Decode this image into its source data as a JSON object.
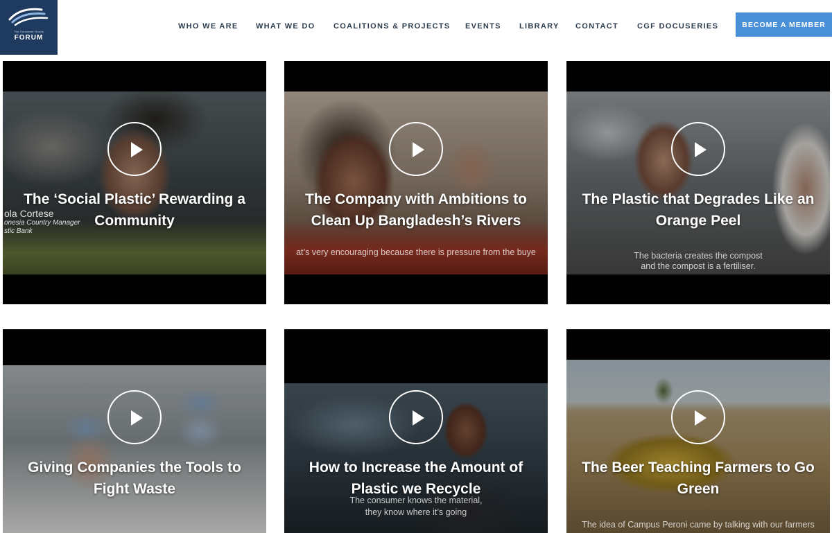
{
  "logo": {
    "small_text": "The Consumer Goods",
    "name": "FORUM"
  },
  "nav": {
    "items": [
      {
        "label": "WHO WE ARE"
      },
      {
        "label": "WHAT WE DO"
      },
      {
        "label": "COALITIONS & PROJECTS"
      },
      {
        "label": "EVENTS"
      },
      {
        "label": "LIBRARY"
      },
      {
        "label": "CONTACT"
      },
      {
        "label": "CGF DOCUSERIES"
      }
    ],
    "cta_label": "BECOME A MEMBER"
  },
  "colors": {
    "brand_navy": "#1f3a5f",
    "accent_blue": "#4a90d6",
    "nav_text": "#2c3d4f"
  },
  "videos": [
    {
      "title": "The ‘Social Plastic’ Rewarding a Community",
      "nameplate_name": "ola Cortese",
      "nameplate_role": "onesia Country Manager",
      "nameplate_org": "stic Bank",
      "caption": ""
    },
    {
      "title": "The Company with Ambitions to Clean Up Bangladesh’s Rivers",
      "caption": "at’s very encouraging because there is pressure from the buye"
    },
    {
      "title": "The Plastic that Degrades Like an Orange Peel",
      "caption": "The bacteria creates the compost",
      "caption2": "and the compost is a fertiliser."
    },
    {
      "title": "Giving Companies the Tools to Fight Waste",
      "caption": ""
    },
    {
      "title": "How to Increase the Amount of Plastic we Recycle",
      "caption": "The consumer knows the material,",
      "caption2": "they know where it’s going"
    },
    {
      "title": "The Beer Teaching Farmers to Go Green",
      "caption": "The idea of Campus Peroni came by talking with our farmers"
    }
  ]
}
